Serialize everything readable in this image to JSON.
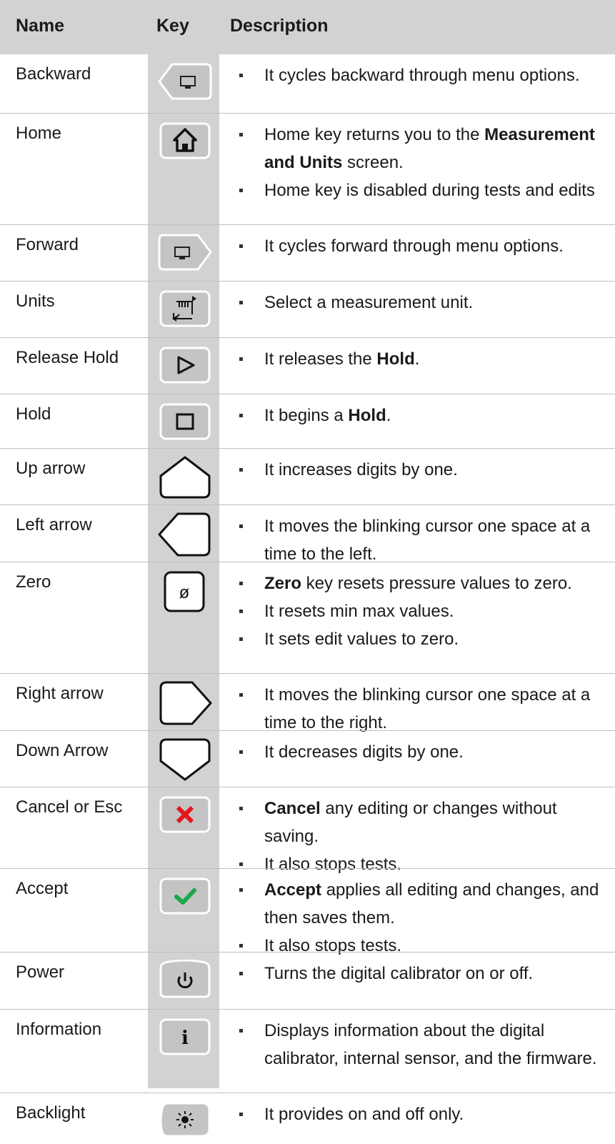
{
  "header": {
    "name": "Name",
    "key": "Key",
    "description": "Description"
  },
  "rows": [
    {
      "name": "Backward",
      "icon": "backward-key-icon",
      "lines": [
        {
          "segments": [
            {
              "t": "It cycles backward through menu options."
            }
          ]
        }
      ]
    },
    {
      "name": "Home",
      "icon": "home-key-icon",
      "lines": [
        {
          "segments": [
            {
              "t": "Home key returns you to the "
            },
            {
              "t": "Measurement and Units",
              "b": true
            },
            {
              "t": " screen."
            }
          ]
        },
        {
          "segments": [
            {
              "t": "Home key is disabled during tests and edits"
            }
          ]
        }
      ]
    },
    {
      "name": "Forward",
      "icon": "forward-key-icon",
      "lines": [
        {
          "segments": [
            {
              "t": "It cycles forward through menu options."
            }
          ]
        }
      ]
    },
    {
      "name": "Units",
      "icon": "units-key-icon",
      "lines": [
        {
          "segments": [
            {
              "t": "Select a measurement unit."
            }
          ]
        }
      ]
    },
    {
      "name": "Release Hold",
      "icon": "play-key-icon",
      "lines": [
        {
          "segments": [
            {
              "t": "It releases the "
            },
            {
              "t": "Hold",
              "b": true
            },
            {
              "t": "."
            }
          ]
        }
      ]
    },
    {
      "name": "Hold",
      "icon": "stop-key-icon",
      "lines": [
        {
          "segments": [
            {
              "t": "It begins a "
            },
            {
              "t": "Hold",
              "b": true
            },
            {
              "t": "."
            }
          ]
        }
      ]
    },
    {
      "name": "Up arrow",
      "icon": "up-arrow-key-icon",
      "lines": [
        {
          "segments": [
            {
              "t": "It increases digits by one."
            }
          ]
        }
      ]
    },
    {
      "name": "Left arrow",
      "icon": "left-arrow-key-icon",
      "lines": [
        {
          "segments": [
            {
              "t": "It moves the blinking cursor one space at a time to the left."
            }
          ]
        }
      ]
    },
    {
      "name": "Zero",
      "icon": "zero-key-icon",
      "glyph": "ø",
      "lines": [
        {
          "segments": [
            {
              "t": "Zero",
              "b": true
            },
            {
              "t": " key resets pressure values to zero."
            }
          ]
        },
        {
          "segments": [
            {
              "t": "It resets min max values."
            }
          ]
        },
        {
          "segments": [
            {
              "t": "It sets edit values to zero."
            }
          ]
        }
      ]
    },
    {
      "name": "Right arrow",
      "icon": "right-arrow-key-icon",
      "lines": [
        {
          "segments": [
            {
              "t": "It moves the blinking cursor one space at a time to the right."
            }
          ]
        }
      ]
    },
    {
      "name": "Down Arrow",
      "icon": "down-arrow-key-icon",
      "lines": [
        {
          "segments": [
            {
              "t": "It decreases digits by one."
            }
          ]
        }
      ]
    },
    {
      "name": "Cancel or Esc",
      "icon": "cancel-key-icon",
      "lines": [
        {
          "segments": [
            {
              "t": "Cancel",
              "b": true
            },
            {
              "t": " any editing or changes without saving."
            }
          ]
        },
        {
          "segments": [
            {
              "t": "It also stops tests."
            }
          ]
        }
      ]
    },
    {
      "name": "Accept",
      "icon": "accept-key-icon",
      "lines": [
        {
          "segments": [
            {
              "t": "Accept",
              "b": true
            },
            {
              "t": " applies all editing and changes, and then saves them."
            }
          ]
        },
        {
          "segments": [
            {
              "t": "It also stops tests."
            }
          ]
        }
      ]
    },
    {
      "name": "Power",
      "icon": "power-key-icon",
      "lines": [
        {
          "segments": [
            {
              "t": "Turns the digital calibrator on or off."
            }
          ]
        }
      ]
    },
    {
      "name": "Information",
      "icon": "info-key-icon",
      "glyph": "i",
      "lines": [
        {
          "segments": [
            {
              "t": "Displays information about the digital calibrator, internal sensor, and the firmware."
            }
          ]
        }
      ]
    },
    {
      "name": "Backlight",
      "icon": "backlight-key-icon",
      "lines": [
        {
          "segments": [
            {
              "t": "It provides on and off only."
            }
          ]
        }
      ]
    }
  ],
  "colors": {
    "cancel": "#e4161d",
    "accept": "#1aa84a",
    "key_face": "#c4c4c4",
    "column": "#d2d2d2"
  }
}
